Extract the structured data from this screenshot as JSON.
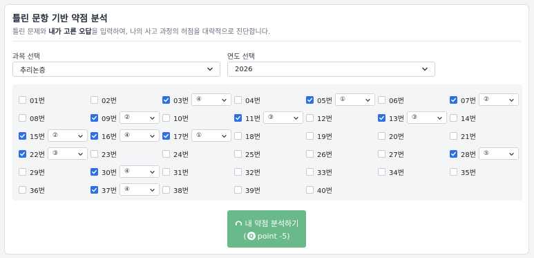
{
  "header": {
    "title": "틀린 문항 기반 약점 분석",
    "subtitle_pre": "틀린 문제와 ",
    "subtitle_bold": "내가 고른 오답",
    "subtitle_post": "을 입력하여, 나의 사고 과정의 허점을 대략적으로 진단합니다."
  },
  "filters": {
    "subject_label": "과목 선택",
    "subject_value": "추리논증",
    "year_label": "연도 선택",
    "year_value": "2026"
  },
  "questions": [
    {
      "label": "01번",
      "checked": false,
      "answer": ""
    },
    {
      "label": "02번",
      "checked": false,
      "answer": ""
    },
    {
      "label": "03번",
      "checked": true,
      "answer": "④"
    },
    {
      "label": "04번",
      "checked": false,
      "answer": ""
    },
    {
      "label": "05번",
      "checked": true,
      "answer": "①"
    },
    {
      "label": "06번",
      "checked": false,
      "answer": ""
    },
    {
      "label": "07번",
      "checked": true,
      "answer": "②"
    },
    {
      "label": "08번",
      "checked": false,
      "answer": ""
    },
    {
      "label": "09번",
      "checked": true,
      "answer": "②"
    },
    {
      "label": "10번",
      "checked": false,
      "answer": ""
    },
    {
      "label": "11번",
      "checked": true,
      "answer": "③"
    },
    {
      "label": "12번",
      "checked": false,
      "answer": ""
    },
    {
      "label": "13번",
      "checked": true,
      "answer": "③"
    },
    {
      "label": "14번",
      "checked": false,
      "answer": ""
    },
    {
      "label": "15번",
      "checked": true,
      "answer": "②"
    },
    {
      "label": "16번",
      "checked": true,
      "answer": "④"
    },
    {
      "label": "17번",
      "checked": true,
      "answer": "①"
    },
    {
      "label": "18번",
      "checked": false,
      "answer": ""
    },
    {
      "label": "19번",
      "checked": false,
      "answer": ""
    },
    {
      "label": "20번",
      "checked": false,
      "answer": ""
    },
    {
      "label": "21번",
      "checked": false,
      "answer": ""
    },
    {
      "label": "22번",
      "checked": true,
      "answer": "③"
    },
    {
      "label": "23번",
      "checked": false,
      "answer": ""
    },
    {
      "label": "24번",
      "checked": false,
      "answer": ""
    },
    {
      "label": "25번",
      "checked": false,
      "answer": ""
    },
    {
      "label": "26번",
      "checked": false,
      "answer": ""
    },
    {
      "label": "27번",
      "checked": false,
      "answer": ""
    },
    {
      "label": "28번",
      "checked": true,
      "answer": "⑤"
    },
    {
      "label": "29번",
      "checked": false,
      "answer": ""
    },
    {
      "label": "30번",
      "checked": true,
      "answer": "④"
    },
    {
      "label": "31번",
      "checked": false,
      "answer": ""
    },
    {
      "label": "32번",
      "checked": false,
      "answer": ""
    },
    {
      "label": "33번",
      "checked": false,
      "answer": ""
    },
    {
      "label": "34번",
      "checked": false,
      "answer": ""
    },
    {
      "label": "35번",
      "checked": false,
      "answer": ""
    },
    {
      "label": "36번",
      "checked": false,
      "answer": ""
    },
    {
      "label": "37번",
      "checked": true,
      "answer": "④"
    },
    {
      "label": "38번",
      "checked": false,
      "answer": ""
    },
    {
      "label": "39번",
      "checked": false,
      "answer": ""
    },
    {
      "label": "40번",
      "checked": false,
      "answer": ""
    }
  ],
  "action": {
    "label": "내 약점 분석하기",
    "coin_symbol": "Q",
    "cost_text": "point -5",
    "open_paren": "(",
    "close_paren": ")"
  },
  "colors": {
    "accent": "#2f6fe4",
    "button": "#6ab98b"
  }
}
